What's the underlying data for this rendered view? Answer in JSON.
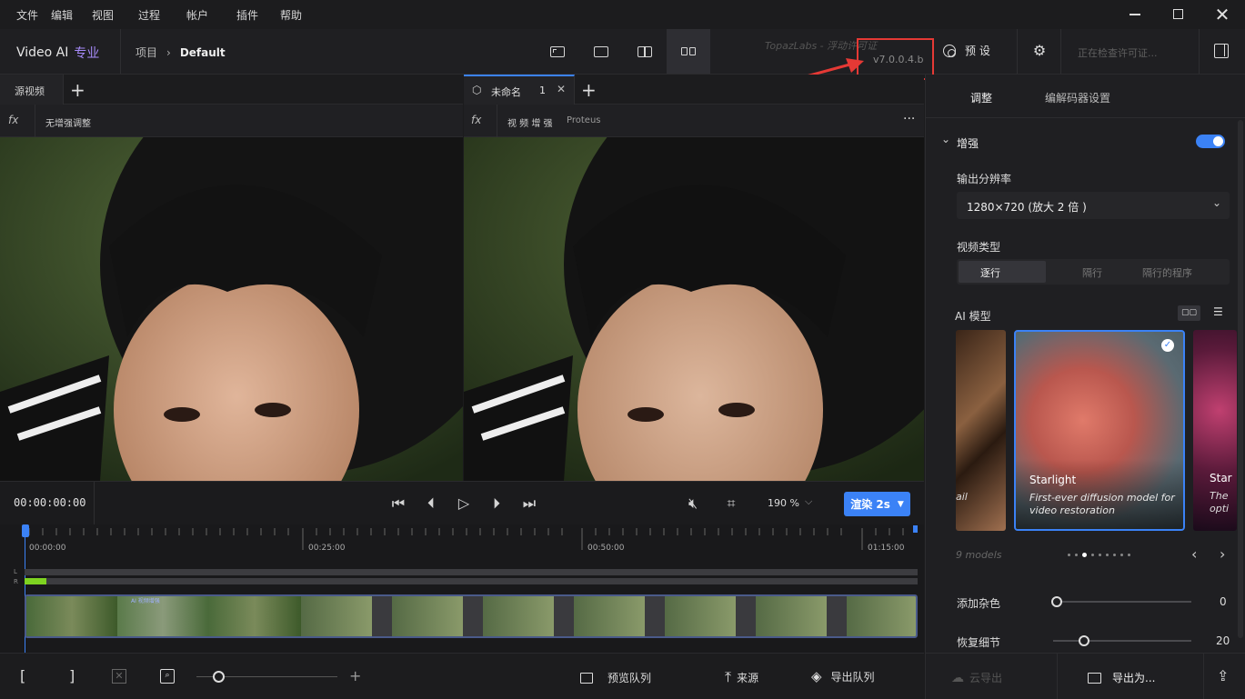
{
  "menu": [
    "文件",
    "编辑",
    "视图",
    "过程",
    "帐户",
    "插件",
    "帮助"
  ],
  "header": {
    "app_name": "Video AI",
    "app_tier": "专业",
    "breadcrumb_project": "项目",
    "breadcrumb_current": "Default",
    "watermark": "TopazLabs - 浮动许可证",
    "version": "v7.0.0.4.b",
    "preset_label": "预 设",
    "license_status": "正在检查许可证..."
  },
  "left_panel": {
    "tab_label": "源视频",
    "fx_label": "无增强调整"
  },
  "right_preview": {
    "tab_label": "未命名",
    "tab_count": "1",
    "fx_label": "视 频 增 强",
    "fx_model": "Proteus",
    "more": "···"
  },
  "controls": {
    "timecode": "00:00:00:00",
    "zoom": "190 %",
    "render_label": "渲染 2s"
  },
  "timeline": {
    "ticks": [
      "00:00:00",
      "00:25:00",
      "00:50:00",
      "01:15:00"
    ],
    "channel_l": "L",
    "channel_r": "R",
    "overlay_label": "AI 视频增强"
  },
  "bottom": {
    "preview_queue": "预览队列",
    "source": "来源",
    "export_queue": "导出队列"
  },
  "right_tabs": {
    "adjust": "调整",
    "codec": "编解码器设置"
  },
  "enhance": {
    "section_title": "增强",
    "enabled": true,
    "output_resolution_label": "输出分辨率",
    "output_resolution_value": "1280×720 (放大 2 倍 )",
    "video_type_label": "视频类型",
    "video_types": [
      "逐行",
      "隔行",
      "隔行的程序"
    ],
    "ai_model_label": "AI 模型",
    "models_count": "9 models",
    "cards": [
      {
        "title": "Starlight",
        "desc": "First-ever diffusion model for video restoration",
        "selected": true
      },
      {
        "title": "Star",
        "desc": "The opti",
        "selected": false
      }
    ],
    "left_card_text": "ail",
    "add_noise_label": "添加杂色",
    "add_noise_value": "0",
    "add_noise_level": 0,
    "recover_detail_label": "恢复细节",
    "recover_detail_value": "20",
    "recover_detail_level": 0.2
  },
  "right_bottom": {
    "cloud_export": "云导出",
    "export_as": "导出为..."
  },
  "colors": {
    "accent": "#3b82f6",
    "active_purple": "#a78bfa",
    "highlight_red": "#e53935"
  }
}
